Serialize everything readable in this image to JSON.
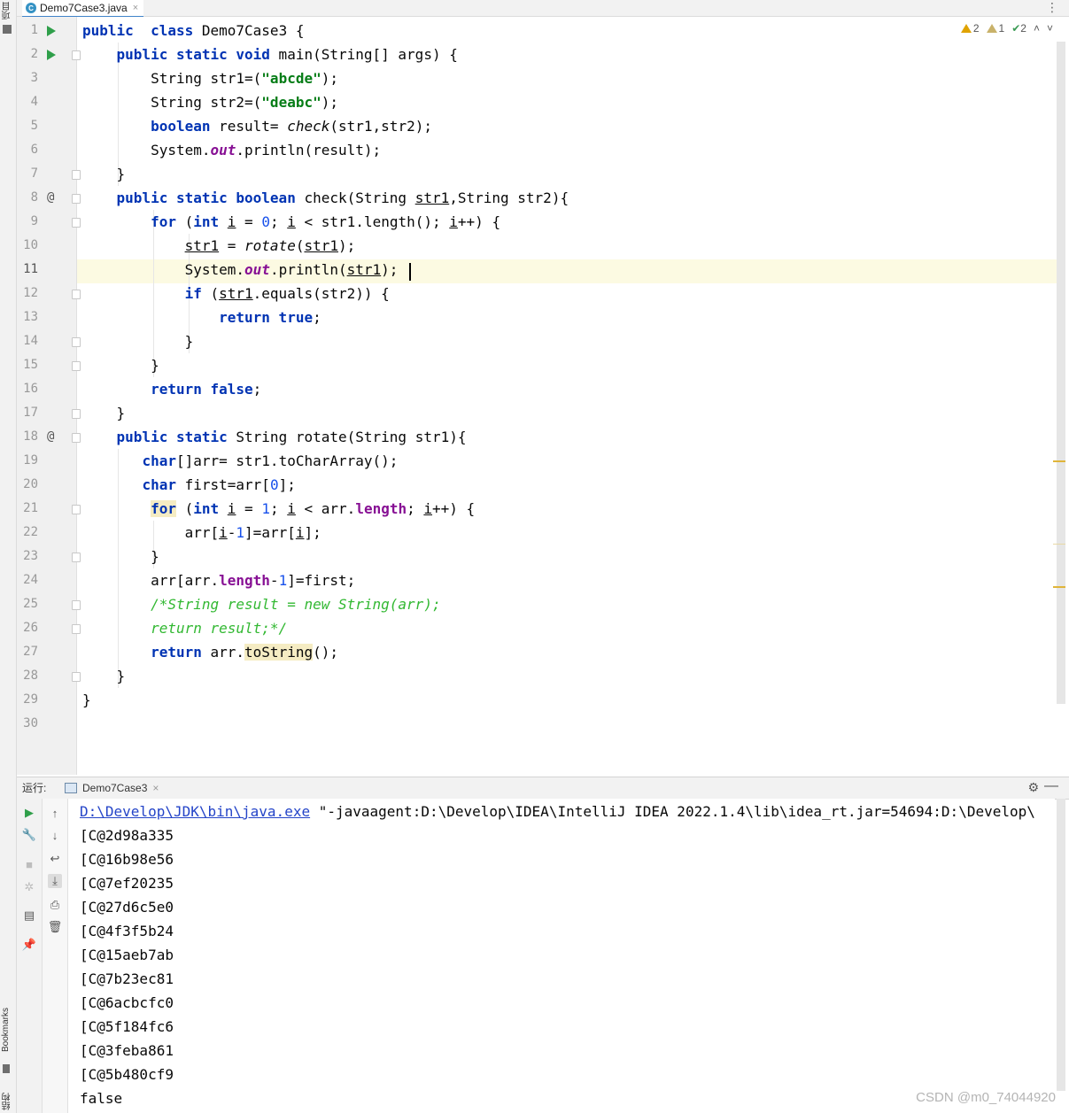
{
  "left_strip": {
    "project_label": "项目",
    "bookmarks_label": "Bookmarks",
    "structure_label": "结构"
  },
  "tab": {
    "file_name": "Demo7Case3.java",
    "file_icon_letter": "C",
    "close_glyph": "×",
    "more_glyph": "⋮"
  },
  "inspections": {
    "warnings": "2",
    "weak_warnings": "1",
    "typos": "2",
    "up_glyph": "˄",
    "down_glyph": "˅",
    "check_glyph": "✔"
  },
  "gutter": {
    "at_symbol": "@"
  },
  "code": {
    "line_numbers": [
      "1",
      "2",
      "3",
      "4",
      "5",
      "6",
      "7",
      "8",
      "9",
      "10",
      "11",
      "12",
      "13",
      "14",
      "15",
      "16",
      "17",
      "18",
      "19",
      "20",
      "21",
      "22",
      "23",
      "24",
      "25",
      "26",
      "27",
      "28",
      "29",
      "30"
    ],
    "lines": [
      [
        [
          "kw",
          "public"
        ],
        [
          "",
          "  "
        ],
        [
          "kw",
          "class"
        ],
        [
          "",
          " Demo7Case3 {"
        ]
      ],
      [
        [
          "",
          "    "
        ],
        [
          "kw",
          "public static void"
        ],
        [
          "",
          " main(String[] args) {"
        ]
      ],
      [
        [
          "",
          "        String str1=("
        ],
        [
          "str",
          "\"abcde\""
        ],
        [
          "",
          ");"
        ]
      ],
      [
        [
          "",
          "        String str2=("
        ],
        [
          "str",
          "\"deabc\""
        ],
        [
          "",
          ");"
        ]
      ],
      [
        [
          "",
          "        "
        ],
        [
          "kw",
          "boolean"
        ],
        [
          "",
          " result= "
        ],
        [
          "st",
          "check"
        ],
        [
          "",
          "(str1,str2);"
        ]
      ],
      [
        [
          "",
          "        System."
        ],
        [
          "sfld",
          "out"
        ],
        [
          "",
          ".println(result);"
        ]
      ],
      [
        [
          "",
          "    }"
        ]
      ],
      [
        [
          "",
          "    "
        ],
        [
          "kw",
          "public static boolean"
        ],
        [
          "",
          " check(String "
        ],
        [
          "var",
          "str1"
        ],
        [
          "",
          ",String str2){"
        ]
      ],
      [
        [
          "",
          "        "
        ],
        [
          "kw",
          "for"
        ],
        [
          "",
          " ("
        ],
        [
          "kw",
          "int"
        ],
        [
          "",
          " "
        ],
        [
          "var",
          "i"
        ],
        [
          "",
          " = "
        ],
        [
          "num",
          "0"
        ],
        [
          "",
          "; "
        ],
        [
          "var",
          "i"
        ],
        [
          "",
          " < str1.length(); "
        ],
        [
          "var",
          "i"
        ],
        [
          "",
          "++) {"
        ]
      ],
      [
        [
          "",
          "            "
        ],
        [
          "var",
          "str1"
        ],
        [
          "",
          " = "
        ],
        [
          "st",
          "rotate"
        ],
        [
          "",
          "("
        ],
        [
          "var",
          "str1"
        ],
        [
          "",
          ");"
        ]
      ],
      [
        [
          "",
          "            System."
        ],
        [
          "sfld",
          "out"
        ],
        [
          "",
          ".println("
        ],
        [
          "var",
          "str1"
        ],
        [
          "",
          ");"
        ]
      ],
      [
        [
          "",
          "            "
        ],
        [
          "kw",
          "if"
        ],
        [
          "",
          " ("
        ],
        [
          "var",
          "str1"
        ],
        [
          "",
          ".equals(str2)) {"
        ]
      ],
      [
        [
          "",
          "                "
        ],
        [
          "kw",
          "return true"
        ],
        [
          "",
          ";"
        ]
      ],
      [
        [
          "",
          "            }"
        ]
      ],
      [
        [
          "",
          "        }"
        ]
      ],
      [
        [
          "",
          "        "
        ],
        [
          "kw",
          "return false"
        ],
        [
          "",
          ";"
        ]
      ],
      [
        [
          "",
          "    }"
        ]
      ],
      [
        [
          "",
          "    "
        ],
        [
          "kw",
          "public static"
        ],
        [
          "",
          " String rotate(String str1){"
        ]
      ],
      [
        [
          "",
          "       "
        ],
        [
          "kw",
          "char"
        ],
        [
          "",
          "[]arr= str1.toCharArray();"
        ]
      ],
      [
        [
          "",
          "       "
        ],
        [
          "kw",
          "char"
        ],
        [
          "",
          " first=arr["
        ],
        [
          "num",
          "0"
        ],
        [
          "",
          "];"
        ]
      ],
      [
        [
          "",
          "        "
        ],
        [
          "kwhl",
          "for"
        ],
        [
          "",
          " ("
        ],
        [
          "kw",
          "int"
        ],
        [
          "",
          " "
        ],
        [
          "var",
          "i"
        ],
        [
          "",
          " = "
        ],
        [
          "num",
          "1"
        ],
        [
          "",
          "; "
        ],
        [
          "var",
          "i"
        ],
        [
          "",
          " < arr."
        ],
        [
          "fld",
          "length"
        ],
        [
          "",
          "; "
        ],
        [
          "var",
          "i"
        ],
        [
          "",
          "++) {"
        ]
      ],
      [
        [
          "",
          "            arr["
        ],
        [
          "var",
          "i"
        ],
        [
          "",
          "-"
        ],
        [
          "num",
          "1"
        ],
        [
          "",
          "]=arr["
        ],
        [
          "var",
          "i"
        ],
        [
          "",
          "];"
        ]
      ],
      [
        [
          "",
          "        }"
        ]
      ],
      [
        [
          "",
          "        arr[arr."
        ],
        [
          "fld",
          "length"
        ],
        [
          "",
          "-"
        ],
        [
          "num",
          "1"
        ],
        [
          "",
          "]=first;"
        ]
      ],
      [
        [
          "",
          "        "
        ],
        [
          "cmt",
          "/*String result = new String(arr);"
        ]
      ],
      [
        [
          "",
          "        "
        ],
        [
          "cmt",
          "return result;*/"
        ]
      ],
      [
        [
          "",
          "        "
        ],
        [
          "kw",
          "return"
        ],
        [
          "",
          " arr."
        ],
        [
          "hl",
          "toString"
        ],
        [
          "",
          "();"
        ]
      ],
      [
        [
          "",
          "    }"
        ]
      ],
      [
        [
          "",
          "}"
        ]
      ],
      [
        [
          "",
          ""
        ]
      ]
    ]
  },
  "run_panel": {
    "title": "运行:",
    "tab_name": "Demo7Case3",
    "close_glyph": "×",
    "gear_glyph": "⚙",
    "minimize_glyph": "—",
    "command_link": "D:\\Develop\\JDK\\bin\\java.exe",
    "command_rest": " \"-javaagent:D:\\Develop\\IDEA\\IntelliJ IDEA 2022.1.4\\lib\\idea_rt.jar=54694:D:\\Develop\\",
    "output": [
      "[C@2d98a335",
      "[C@16b98e56",
      "[C@7ef20235",
      "[C@27d6c5e0",
      "[C@4f3f5b24",
      "[C@15aeb7ab",
      "[C@7b23ec81",
      "[C@6acbcfc0",
      "[C@5f184fc6",
      "[C@3feba861",
      "[C@5b480cf9",
      "false"
    ],
    "tools_left": [
      {
        "name": "rerun-icon",
        "glyph": "▶",
        "color": "#2f9f4a"
      },
      {
        "name": "wrench-icon",
        "glyph": "🔧",
        "color": "#555"
      },
      {
        "name": "stop-icon",
        "glyph": "■",
        "color": "#bdbdbd"
      },
      {
        "name": "debug-icon",
        "glyph": "✲",
        "color": "#bdbdbd"
      },
      {
        "name": "layout-icon",
        "glyph": "▤",
        "color": "#555"
      },
      {
        "name": "pin-icon",
        "glyph": "📌",
        "color": "#555"
      }
    ],
    "tools_right": [
      {
        "name": "up-arrow-icon",
        "glyph": "↑"
      },
      {
        "name": "down-arrow-icon",
        "glyph": "↓"
      },
      {
        "name": "soft-wrap-icon",
        "glyph": "↩"
      },
      {
        "name": "scroll-to-end-icon",
        "glyph": "⤓"
      },
      {
        "name": "print-icon",
        "glyph": "⎙"
      },
      {
        "name": "trash-icon",
        "glyph": "🗑"
      }
    ]
  },
  "watermark": "CSDN @m0_74044920"
}
